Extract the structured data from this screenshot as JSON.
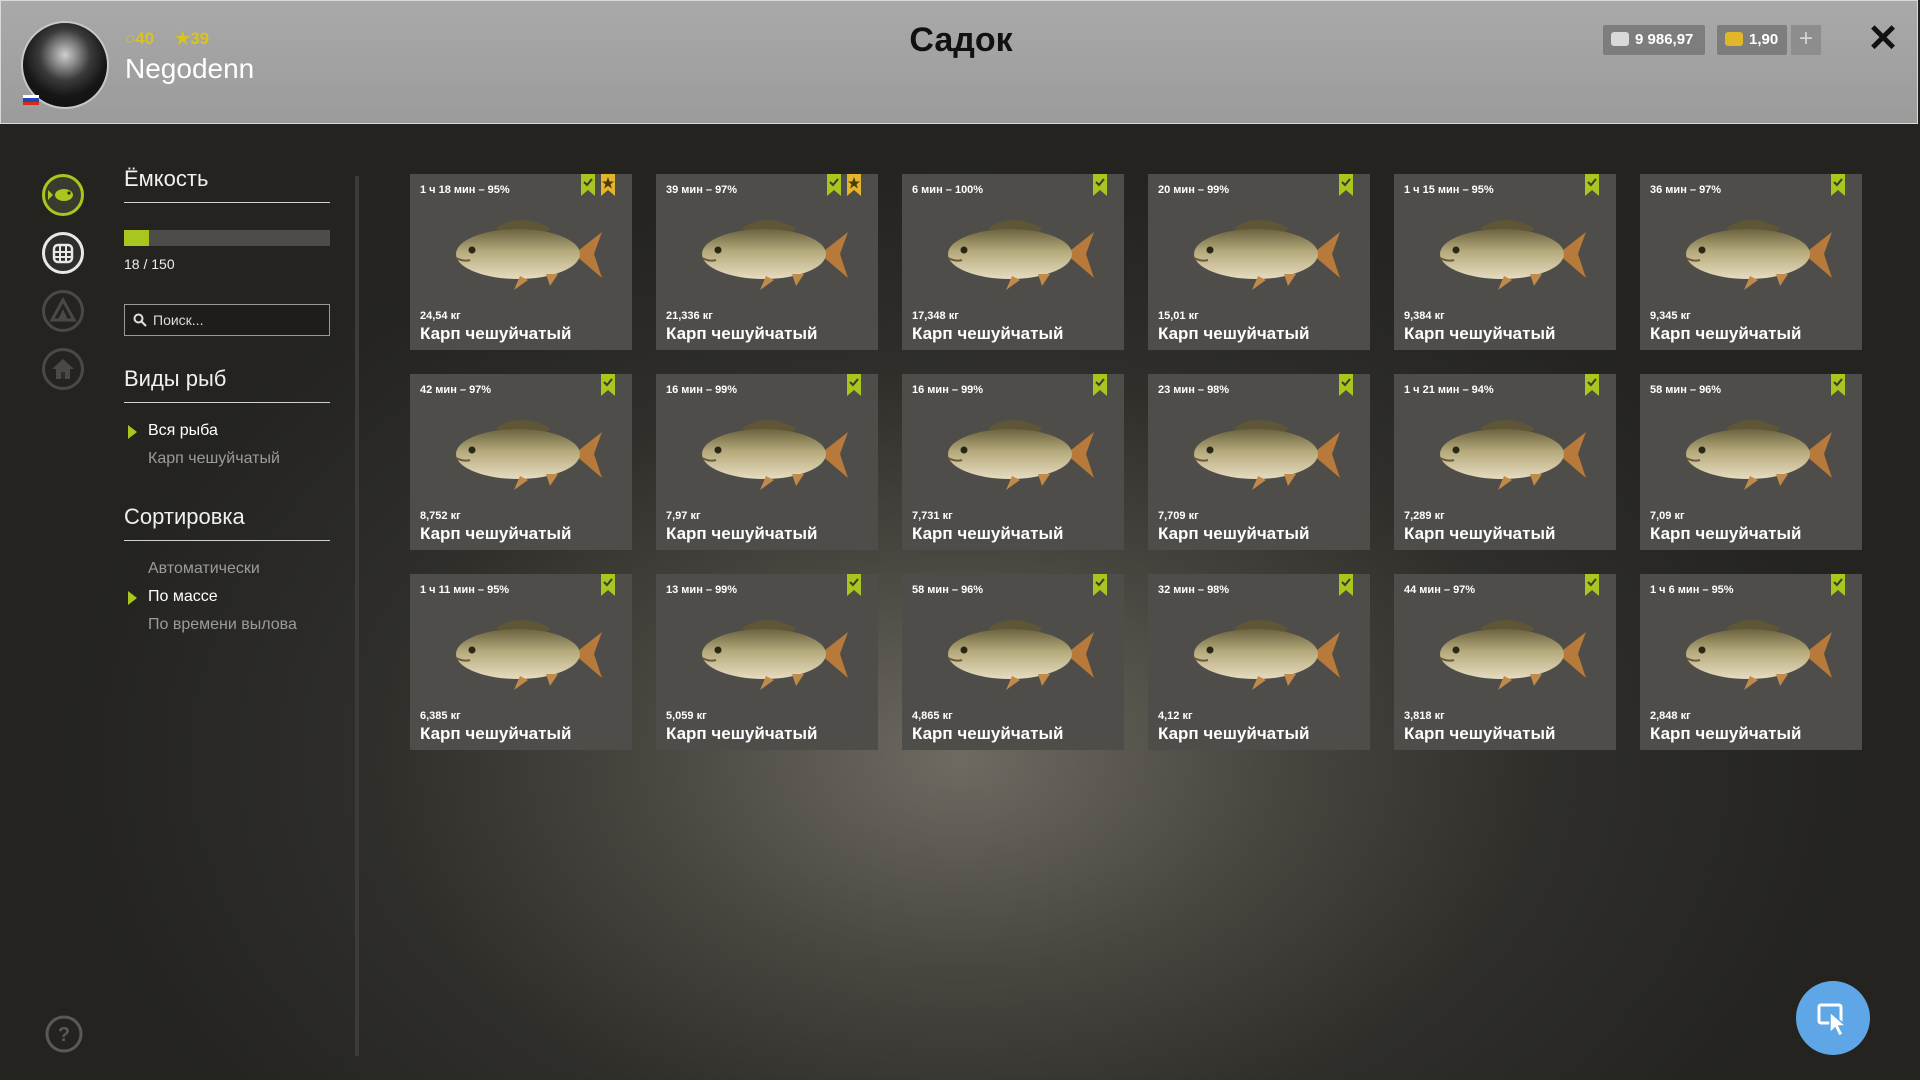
{
  "header": {
    "title": "Садок",
    "player": {
      "name": "Negodenn",
      "level": "40",
      "rank": "39"
    },
    "currency": {
      "silver": "9 986,97",
      "gold": "1,90"
    },
    "plus_label": "+",
    "close_label": "✕"
  },
  "colors": {
    "accent": "#a9c61e",
    "header_bg": "#9e9e9e",
    "card_bg": "#4e4d49",
    "help_blue": "#5fa6e6"
  },
  "rail_icons": [
    "fish-icon",
    "keepnet-icon",
    "camp-icon",
    "home-icon"
  ],
  "sidebar": {
    "capacity_title": "Ёмкость",
    "capacity_used": 18,
    "capacity_total": 150,
    "capacity_text": "18 / 150",
    "search_placeholder": "Поиск...",
    "species_title": "Виды рыб",
    "species": [
      {
        "label": "Вся рыба",
        "active": true
      },
      {
        "label": "Карп чешуйчатый",
        "active": false
      }
    ],
    "sort_title": "Сортировка",
    "sort_options": [
      {
        "label": "Автоматически",
        "active": false
      },
      {
        "label": "По массе",
        "active": true
      },
      {
        "label": "По времени вылова",
        "active": false
      }
    ]
  },
  "fish_cards": [
    {
      "time": "1 ч 18 мин – 95%",
      "weight": "24,54 кг",
      "name": "Карп чешуйчатый",
      "star": true
    },
    {
      "time": "39 мин – 97%",
      "weight": "21,336 кг",
      "name": "Карп чешуйчатый",
      "star": true
    },
    {
      "time": "6 мин – 100%",
      "weight": "17,348 кг",
      "name": "Карп чешуйчатый",
      "star": false
    },
    {
      "time": "20 мин – 99%",
      "weight": "15,01 кг",
      "name": "Карп чешуйчатый",
      "star": false
    },
    {
      "time": "1 ч 15 мин – 95%",
      "weight": "9,384 кг",
      "name": "Карп чешуйчатый",
      "star": false
    },
    {
      "time": "36 мин – 97%",
      "weight": "9,345 кг",
      "name": "Карп чешуйчатый",
      "star": false
    },
    {
      "time": "42 мин – 97%",
      "weight": "8,752 кг",
      "name": "Карп чешуйчатый",
      "star": false
    },
    {
      "time": "16 мин – 99%",
      "weight": "7,97 кг",
      "name": "Карп чешуйчатый",
      "star": false
    },
    {
      "time": "16 мин – 99%",
      "weight": "7,731 кг",
      "name": "Карп чешуйчатый",
      "star": false
    },
    {
      "time": "23 мин – 98%",
      "weight": "7,709 кг",
      "name": "Карп чешуйчатый",
      "star": false
    },
    {
      "time": "1 ч 21 мин – 94%",
      "weight": "7,289 кг",
      "name": "Карп чешуйчатый",
      "star": false
    },
    {
      "time": "58 мин – 96%",
      "weight": "7,09 кг",
      "name": "Карп чешуйчатый",
      "star": false
    },
    {
      "time": "1 ч 11 мин – 95%",
      "weight": "6,385 кг",
      "name": "Карп чешуйчатый",
      "star": false
    },
    {
      "time": "13 мин – 99%",
      "weight": "5,059 кг",
      "name": "Карп чешуйчатый",
      "star": false
    },
    {
      "time": "58 мин – 96%",
      "weight": "4,865 кг",
      "name": "Карп чешуйчатый",
      "star": false
    },
    {
      "time": "32 мин – 98%",
      "weight": "4,12 кг",
      "name": "Карп чешуйчатый",
      "star": false
    },
    {
      "time": "44 мин – 97%",
      "weight": "3,818 кг",
      "name": "Карп чешуйчатый",
      "star": false
    },
    {
      "time": "1 ч 6 мин – 95%",
      "weight": "2,848 кг",
      "name": "Карп чешуйчатый",
      "star": false
    }
  ]
}
